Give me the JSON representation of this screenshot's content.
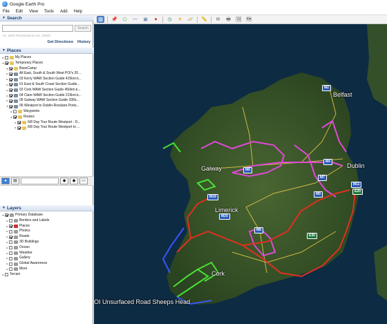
{
  "window": {
    "title": "Google Earth Pro",
    "icon": "google-earth-globe-icon"
  },
  "menu": [
    "File",
    "Edit",
    "View",
    "Tools",
    "Add",
    "Help"
  ],
  "search": {
    "header": "Search",
    "placeholder": "",
    "button": "Search",
    "hint": "ex: 1600 Pennsylvania Ave, 20500",
    "links": [
      "Get Directions",
      "History"
    ]
  },
  "places": {
    "header": "Places",
    "items": [
      {
        "label": "My Places",
        "level": 1,
        "icon": "folder",
        "checked": false,
        "expanded": false
      },
      {
        "label": "Temporary Places",
        "level": 1,
        "icon": "folder",
        "checked": true,
        "expanded": true
      },
      {
        "label": "BaseCamp",
        "level": 2,
        "icon": "folder",
        "checked": true,
        "expanded": true
      },
      {
        "label": "All East, South & South West POI's 20...",
        "level": 2,
        "icon": "kml",
        "checked": true,
        "expanded": false
      },
      {
        "label": "03 Kerry WAW Section Guide 415km.k...",
        "level": 2,
        "icon": "kml",
        "checked": true,
        "expanded": false
      },
      {
        "label": "01 East & South Coast Section Guide...",
        "level": 2,
        "icon": "kml",
        "checked": true,
        "expanded": false
      },
      {
        "label": "02 Cork WAW Section Guide 450km.k...",
        "level": 2,
        "icon": "kml",
        "checked": true,
        "expanded": false
      },
      {
        "label": "04 Clare WAW Section Guide 215km.k...",
        "level": 2,
        "icon": "kml",
        "checked": true,
        "expanded": false
      },
      {
        "label": "05 Galway WAW Section Guide 335k...",
        "level": 2,
        "icon": "kml",
        "checked": true,
        "expanded": false
      },
      {
        "label": "06 Westport to Dublin-Rosslare Ports...",
        "level": 2,
        "icon": "kml",
        "checked": true,
        "expanded": true
      },
      {
        "label": "Waypoints",
        "level": 3,
        "icon": "folder",
        "checked": false,
        "expanded": false
      },
      {
        "label": "Routes",
        "level": 3,
        "icon": "folder",
        "checked": true,
        "expanded": true
      },
      {
        "label": "6/8 Day Tour Route Westport - D...",
        "level": 4,
        "icon": "folder",
        "checked": true,
        "expanded": false
      },
      {
        "label": "6/8 Day Tour Route Westport to ...",
        "level": 4,
        "icon": "folder",
        "checked": true,
        "expanded": false
      }
    ]
  },
  "layers": {
    "header": "Layers",
    "items": [
      {
        "label": "Primary Database",
        "level": 1,
        "icon": "grey",
        "checked": true,
        "expanded": true
      },
      {
        "label": "Borders and Labels",
        "level": 2,
        "icon": "grey",
        "checked": false,
        "expanded": false
      },
      {
        "label": "Places",
        "level": 2,
        "icon": "red",
        "checked": true,
        "expanded": false
      },
      {
        "label": "Photos",
        "level": 2,
        "icon": "grey",
        "checked": false,
        "expanded": false
      },
      {
        "label": "Roads",
        "level": 2,
        "icon": "grey",
        "checked": true,
        "expanded": false
      },
      {
        "label": "3D Buildings",
        "level": 2,
        "icon": "grey",
        "checked": false,
        "expanded": false
      },
      {
        "label": "Ocean",
        "level": 2,
        "icon": "grey",
        "checked": false,
        "expanded": false
      },
      {
        "label": "Weather",
        "level": 2,
        "icon": "grey",
        "checked": false,
        "expanded": false
      },
      {
        "label": "Gallery",
        "level": 2,
        "icon": "grey",
        "checked": false,
        "expanded": false
      },
      {
        "label": "Global Awareness",
        "level": 2,
        "icon": "grey",
        "checked": false,
        "expanded": false
      },
      {
        "label": "More",
        "level": 2,
        "icon": "grey",
        "checked": false,
        "expanded": false
      },
      {
        "label": "Terrain",
        "level": 1,
        "icon": "none",
        "checked": false,
        "expanded": false
      }
    ]
  },
  "map": {
    "cities": [
      "Belfast",
      "Galway",
      "Dublin",
      "Limerick",
      "Cork"
    ],
    "roads": [
      "M2",
      "M6",
      "M4",
      "M7",
      "M9",
      "M18",
      "M20",
      "M8",
      "M11",
      "E30",
      "E20"
    ],
    "caption": "OI Unsurfaced Road Sheeps Head"
  },
  "colors": {
    "route_pink": "#e048d8",
    "route_red": "#e0301f",
    "route_green": "#49e036",
    "route_blue": "#3c54ff",
    "road_yellow": "#f2d24b",
    "ocean": "#0e2b44",
    "land": "#2e4a22"
  }
}
